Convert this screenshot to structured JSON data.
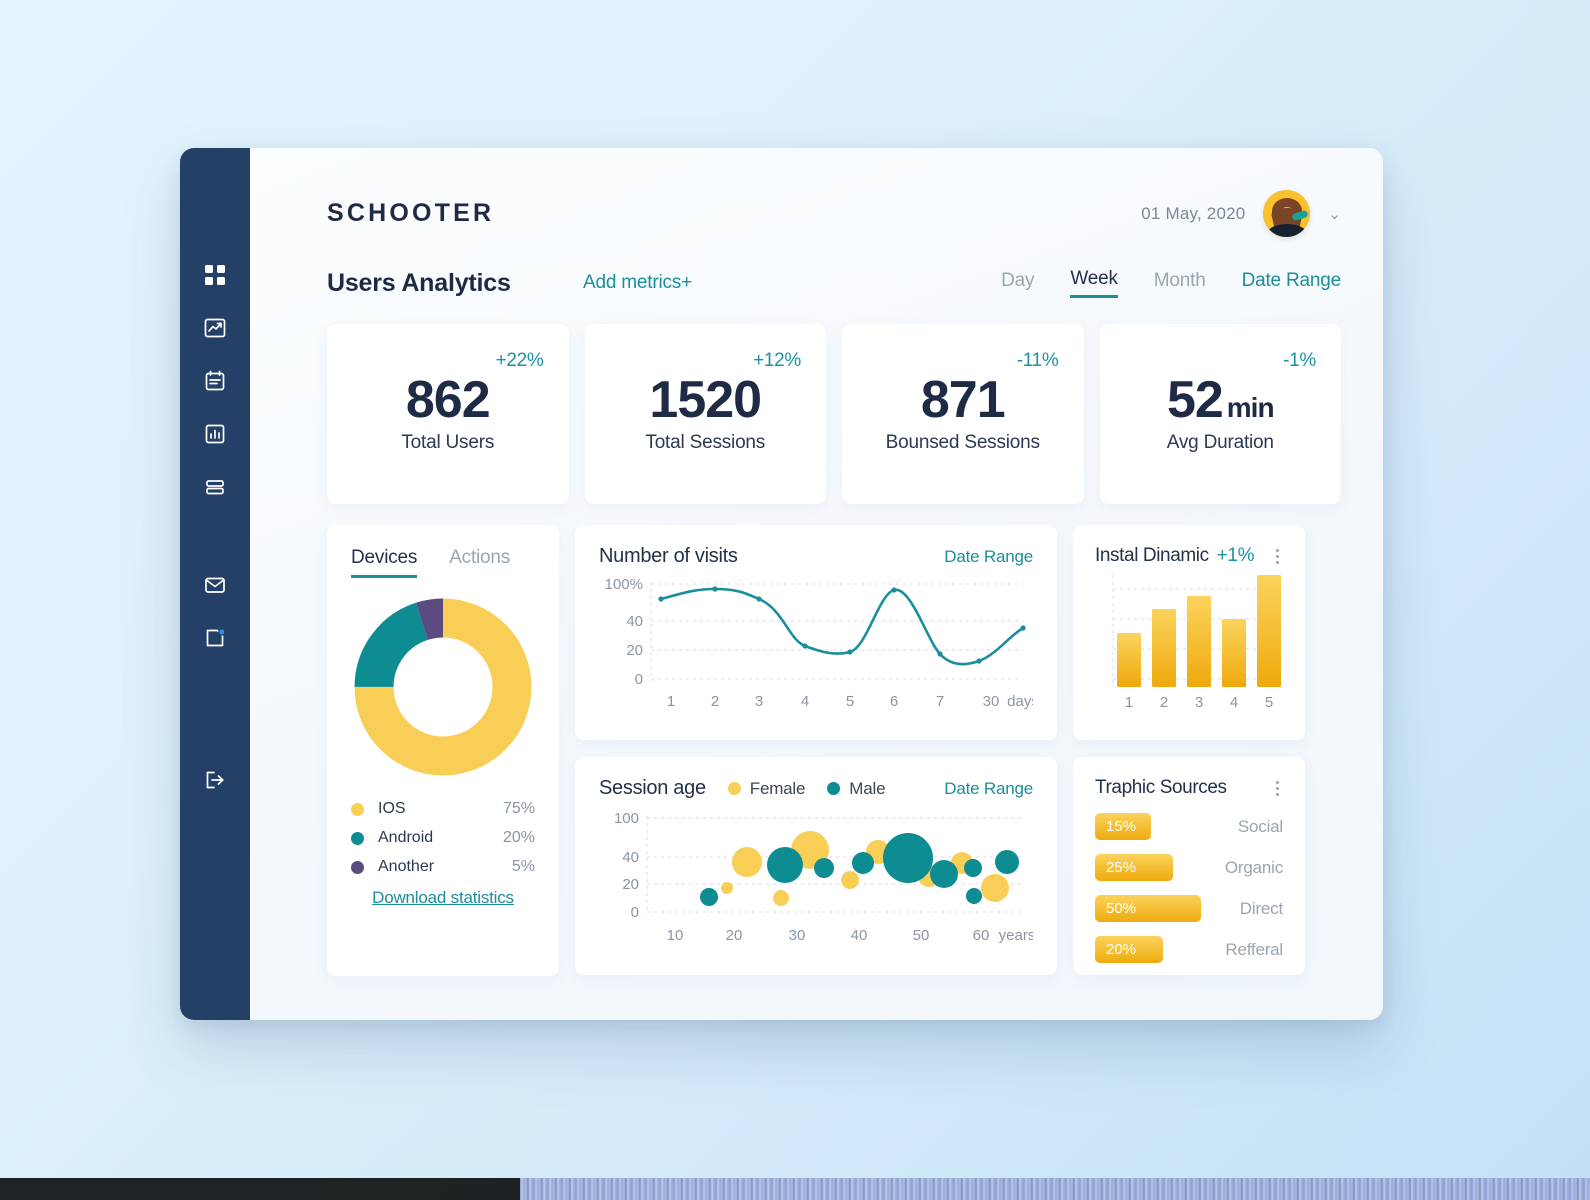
{
  "brand": "SCHOOTER",
  "header": {
    "date": "01 May, 2020",
    "avatar_icon": "user-avatar",
    "chevron": "⌄"
  },
  "page_title": "Users Analytics",
  "add_metrics_label": "Add metrics+",
  "periods": [
    {
      "label": "Day",
      "active": false,
      "link": false
    },
    {
      "label": "Week",
      "active": true,
      "link": false
    },
    {
      "label": "Month",
      "active": false,
      "link": false
    },
    {
      "label": "Date Range",
      "active": false,
      "link": true
    }
  ],
  "kpis": [
    {
      "pct": "+22%",
      "value": "862",
      "unit": "",
      "label": "Total Users"
    },
    {
      "pct": "+12%",
      "value": "1520",
      "unit": "",
      "label": "Total Sessions"
    },
    {
      "pct": "-11%",
      "value": "871",
      "unit": "",
      "label": "Bounsed Sessions"
    },
    {
      "pct": "-1%",
      "value": "52",
      "unit": "min",
      "label": "Avg Duration"
    }
  ],
  "devices": {
    "tabs": [
      {
        "label": "Devices",
        "active": true
      },
      {
        "label": "Actions",
        "active": false
      }
    ],
    "legend": [
      {
        "name": "IOS",
        "value": "75%",
        "color": "#F8CE56"
      },
      {
        "name": "Android",
        "value": "20%",
        "color": "#0D8C92"
      },
      {
        "name": "Another",
        "value": "5%",
        "color": "#5B4B80"
      }
    ],
    "download_link": "Download statistics"
  },
  "visits": {
    "title": "Number of visits",
    "date_range_label": "Date Range"
  },
  "session_age": {
    "title": "Session age",
    "legend": [
      {
        "name": "Female",
        "color": "#F8CE56"
      },
      {
        "name": "Male",
        "color": "#0D8C92"
      }
    ],
    "date_range_label": "Date Range"
  },
  "instal": {
    "title": "Instal Dinamic",
    "pct": "+1%",
    "menu_icon": "kebab-menu-icon"
  },
  "traffic": {
    "title": "Traphic Sources",
    "menu_icon": "kebab-menu-icon",
    "rows": [
      {
        "value": "15%",
        "label": "Social"
      },
      {
        "value": "25%",
        "label": "Organic"
      },
      {
        "value": "50%",
        "label": "Direct"
      },
      {
        "value": "20%",
        "label": "Refferal"
      }
    ]
  },
  "sidebar": {
    "items": [
      {
        "icon": "grid-dashboard-icon"
      },
      {
        "icon": "trending-chart-icon"
      },
      {
        "icon": "clipboard-notes-icon"
      },
      {
        "icon": "bar-chart-icon"
      },
      {
        "icon": "layers-stack-icon"
      },
      {
        "icon": "mail-envelope-icon"
      },
      {
        "icon": "document-notification-icon"
      },
      {
        "icon": "logout-icon"
      }
    ]
  },
  "colors": {
    "accent_teal": "#1b8e9b",
    "accent_yellow": "#F8CE56",
    "navy": "#254066",
    "purple": "#5B4B80"
  },
  "chart_data": [
    {
      "type": "pie",
      "name": "devices-donut",
      "title": "Devices",
      "labels": [
        "IOS",
        "Android",
        "Another"
      ],
      "values": [
        75,
        20,
        5
      ],
      "colors": [
        "#F8CE56",
        "#0D8C92",
        "#5B4B80"
      ],
      "donut": true,
      "legend_position": "bottom"
    },
    {
      "type": "line",
      "name": "number-of-visits",
      "title": "Number of visits",
      "x": [
        "1",
        "2",
        "3",
        "4",
        "5",
        "6",
        "7",
        "30"
      ],
      "xlabel": "days",
      "ylabel": "",
      "ytick_labels": [
        "100%",
        "40",
        "20",
        "0"
      ],
      "ytick_values": [
        100,
        40,
        20,
        0
      ],
      "ylim": [
        0,
        105
      ],
      "values": [
        80,
        95,
        80,
        35,
        28,
        97,
        23,
        38
      ],
      "markers": true,
      "smooth": true,
      "grid": true,
      "color": "#1b8e9b"
    },
    {
      "type": "bar",
      "name": "instal-dinamic",
      "title": "Instal Dinamic",
      "categories": [
        "1",
        "2",
        "3",
        "4",
        "5"
      ],
      "values": [
        48,
        70,
        81,
        61,
        100
      ],
      "ylim": [
        0,
        100
      ],
      "grid": true,
      "color": "#F0B415"
    },
    {
      "type": "scatter",
      "name": "session-age-bubbles",
      "title": "Session age",
      "xlabel": "years",
      "xtick_labels": [
        "10",
        "20",
        "30",
        "40",
        "50",
        "60"
      ],
      "xtick_values": [
        10,
        20,
        30,
        40,
        50,
        60
      ],
      "ytick_labels": [
        "100",
        "40",
        "20",
        "0"
      ],
      "ytick_values": [
        100,
        40,
        20,
        0
      ],
      "ylim": [
        0,
        105
      ],
      "series": [
        {
          "name": "Female",
          "color": "#F8CE56",
          "points": [
            {
              "x": 18.5,
              "y": 21,
              "r": 7
            },
            {
              "x": 22,
              "y": 36,
              "r": 17
            },
            {
              "x": 27.5,
              "y": 15,
              "r": 9
            },
            {
              "x": 32,
              "y": 48,
              "r": 22
            },
            {
              "x": 38.5,
              "y": 24,
              "r": 10
            },
            {
              "x": 43,
              "y": 47,
              "r": 13
            },
            {
              "x": 51,
              "y": 27,
              "r": 12
            },
            {
              "x": 56.5,
              "y": 36,
              "r": 12
            },
            {
              "x": 63.5,
              "y": 20,
              "r": 16
            }
          ]
        },
        {
          "name": "Male",
          "color": "#0D8C92",
          "points": [
            {
              "x": 15.5,
              "y": 15,
              "r": 10
            },
            {
              "x": 27,
              "y": 33,
              "r": 21
            },
            {
              "x": 34,
              "y": 30,
              "r": 11
            },
            {
              "x": 41,
              "y": 34,
              "r": 12
            },
            {
              "x": 48,
              "y": 40,
              "r": 29
            },
            {
              "x": 55,
              "y": 28,
              "r": 16
            },
            {
              "x": 59.5,
              "y": 30,
              "r": 10
            },
            {
              "x": 61,
              "y": 15,
              "r": 9
            },
            {
              "x": 66,
              "y": 38,
              "r": 14
            }
          ]
        }
      ]
    },
    {
      "type": "bar",
      "name": "traphic-sources",
      "title": "Traphic Sources",
      "orientation": "horizontal",
      "categories": [
        "Social",
        "Organic",
        "Direct",
        "Refferal"
      ],
      "values": [
        15,
        25,
        50,
        20
      ],
      "color": "#F0B415"
    }
  ]
}
